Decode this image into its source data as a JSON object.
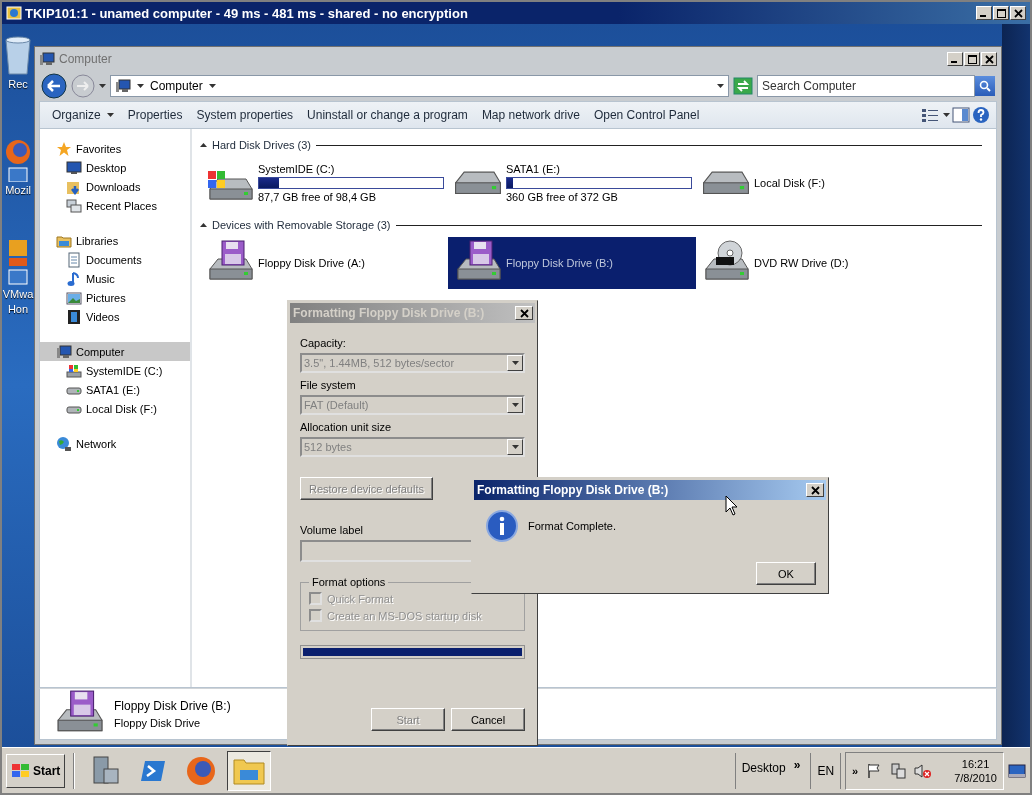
{
  "remote_window": {
    "title": "TKIP101:1 - unamed computer - 49 ms - 481 ms - shared - no encryption"
  },
  "desktop_icons": [
    {
      "kind": "recycle",
      "lines": [
        "Rec"
      ]
    },
    {
      "kind": "browser",
      "lines": [
        "Mozil"
      ]
    },
    {
      "kind": "vm",
      "lines": [
        "VMwa",
        "Hon"
      ]
    }
  ],
  "explorer": {
    "title": "Computer",
    "address": "Computer",
    "search": {
      "placeholder": "Search Computer"
    },
    "toolbar": [
      {
        "label": "Organize",
        "dropdown": true
      },
      {
        "label": "Properties",
        "dropdown": false
      },
      {
        "label": "System properties",
        "dropdown": false
      },
      {
        "label": "Uninstall or change a program",
        "dropdown": false
      },
      {
        "label": "Map network drive",
        "dropdown": false
      },
      {
        "label": "Open Control Panel",
        "dropdown": false
      }
    ],
    "sidebar": [
      {
        "label": "Favorites",
        "kind": "star",
        "selected": false,
        "children": [
          {
            "label": "Desktop",
            "kind": "desktop",
            "selected": false
          },
          {
            "label": "Downloads",
            "kind": "downloads",
            "selected": false
          },
          {
            "label": "Recent Places",
            "kind": "recent",
            "selected": false
          }
        ]
      },
      {
        "label": "Libraries",
        "kind": "library",
        "selected": false,
        "children": [
          {
            "label": "Documents",
            "kind": "documents",
            "selected": false
          },
          {
            "label": "Music",
            "kind": "music",
            "selected": false
          },
          {
            "label": "Pictures",
            "kind": "pictures",
            "selected": false
          },
          {
            "label": "Videos",
            "kind": "videos",
            "selected": false
          }
        ]
      },
      {
        "label": "Computer",
        "kind": "computer",
        "selected": true,
        "children": [
          {
            "label": "SystemIDE (C:)",
            "kind": "windows-drive",
            "selected": false
          },
          {
            "label": "SATA1 (E:)",
            "kind": "drive",
            "selected": false
          },
          {
            "label": "Local Disk (F:)",
            "kind": "drive",
            "selected": false
          }
        ]
      },
      {
        "label": "Network",
        "kind": "network",
        "selected": false
      }
    ],
    "sections": [
      {
        "title": "Hard Disk Drives (3)",
        "items": [
          {
            "name": "SystemIDE (C:)",
            "kind": "windows-drive",
            "selected": false,
            "level": 0.11,
            "free": "87,7 GB free of 98,4 GB"
          },
          {
            "name": "SATA1 (E:)",
            "kind": "drive",
            "selected": false,
            "level": 0.03,
            "free": "360 GB free of 372 GB"
          },
          {
            "name": "Local Disk (F:)",
            "kind": "drive",
            "selected": false
          }
        ]
      },
      {
        "title": "Devices with Removable Storage (3)",
        "items": [
          {
            "name": "Floppy Disk Drive (A:)",
            "kind": "floppy",
            "selected": false
          },
          {
            "name": "Floppy Disk Drive (B:)",
            "kind": "floppy",
            "selected": true
          },
          {
            "name": "DVD RW Drive (D:)",
            "kind": "dvd",
            "selected": false
          }
        ]
      }
    ],
    "details": {
      "kind": "floppy",
      "name": "Floppy Disk Drive (B:)",
      "type": "Floppy Disk Drive"
    }
  },
  "format_dialog": {
    "title": "Formatting Floppy Disk Drive (B:)",
    "active": false,
    "fields": [
      {
        "label": "Capacity:",
        "value": "3.5\",  1.44MB, 512 bytes/sector",
        "disabled": true
      },
      {
        "label": "File system",
        "value": "FAT (Default)",
        "disabled": true
      },
      {
        "label": "Allocation unit size",
        "value": "512 bytes",
        "disabled": true
      }
    ],
    "restore_button": {
      "label": "Restore device defaults",
      "disabled": true
    },
    "volume_label": {
      "label": "Volume label",
      "disabled": true
    },
    "options": {
      "title": "Format options",
      "items": [
        {
          "label": "Quick Format",
          "checked": false,
          "disabled": true
        },
        {
          "label": "Create an MS-DOS startup disk",
          "checked": false,
          "disabled": true
        }
      ]
    },
    "progress": {
      "level": 1
    },
    "buttons": [
      {
        "label": "Start",
        "disabled": true
      },
      {
        "label": "Cancel",
        "disabled": false
      }
    ]
  },
  "message_box": {
    "title": "Formatting Floppy Disk Drive (B:)",
    "active": true,
    "message": "Format Complete.",
    "button": "OK"
  },
  "taskbar": {
    "start": "Start",
    "quick_launch": [
      {
        "kind": "server",
        "active": false
      },
      {
        "kind": "shell",
        "active": false
      },
      {
        "kind": "browser",
        "active": false
      },
      {
        "kind": "explorer",
        "active": true
      }
    ],
    "toolbar": {
      "label": "Desktop",
      "more": "»"
    },
    "language": "EN",
    "tray": {
      "expand": "»"
    },
    "time": "16:21",
    "date": "7/8/2010"
  }
}
